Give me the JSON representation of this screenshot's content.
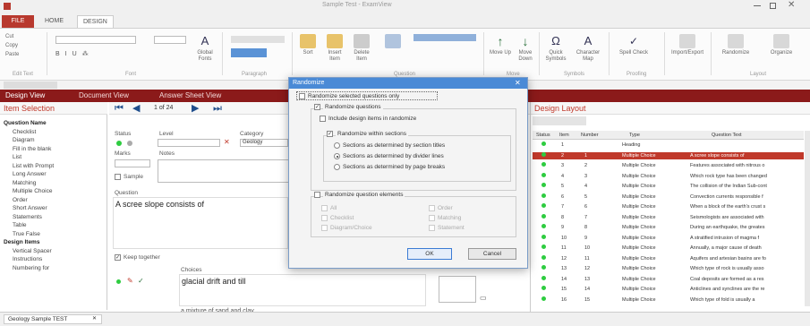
{
  "ribbon": {
    "tabs": [
      "FILE",
      "HOME",
      "DESIGN"
    ],
    "title": "Sample Test - ExamView",
    "groups": [
      "Edit Text",
      "Font",
      "Paragraph",
      "Style",
      "Question",
      "Move",
      "Symbols",
      "Proofing",
      "Window",
      "Layout"
    ],
    "buttons": [
      "Cut",
      "Copy",
      "Paste",
      "Global Fonts",
      "Sort",
      "Insert Item",
      "Delete Item",
      "Move Up",
      "Move Down",
      "Quick Symbols",
      "Character Map",
      "Spell Check",
      "Import/Export",
      "Randomize",
      "Organize"
    ]
  },
  "views": [
    "Design View",
    "Document View",
    "Answer Sheet View"
  ],
  "item_selection": {
    "title": "Item Selection",
    "nav_counter": "1 of 24",
    "tree": [
      {
        "label": "Question Name",
        "header": true
      },
      {
        "label": "Checklist",
        "header": false
      },
      {
        "label": "Diagram",
        "header": false
      },
      {
        "label": "Fill in the blank",
        "header": false
      },
      {
        "label": "List",
        "header": false
      },
      {
        "label": "List with Prompt",
        "header": false
      },
      {
        "label": "Long Answer",
        "header": false
      },
      {
        "label": "Matching",
        "header": false
      },
      {
        "label": "Multiple Choice",
        "header": false
      },
      {
        "label": "Order",
        "header": false
      },
      {
        "label": "Short Answer",
        "header": false
      },
      {
        "label": "Statements",
        "header": false
      },
      {
        "label": "Table",
        "header": false
      },
      {
        "label": "True False",
        "header": false
      },
      {
        "label": "Design Items",
        "header": true
      },
      {
        "label": "Vertical Spacer",
        "header": false
      },
      {
        "label": "Instructions",
        "header": false
      },
      {
        "label": "Numbering for",
        "header": false
      }
    ]
  },
  "editor": {
    "status_label": "Status",
    "level_label": "Level",
    "category_label": "Category",
    "category_value": "Geology",
    "marks_label": "Marks",
    "notes_label": "Notes",
    "sample_label": "Sample",
    "question_label": "Question",
    "question_text": "A scree slope consists of",
    "keep_together_label": "Keep together",
    "choices_label": "Choices",
    "choice_a": "glacial drift and till",
    "choice_b": "a mixture of sand and clay"
  },
  "dialog": {
    "title": "Randomize",
    "selected_only": "Randomize selected questions only",
    "randomize_questions": "Randomize questions",
    "include_design": "Include design items in randomize",
    "randomize_within": "Randomize within sections",
    "radio_1": "Sections as determined by section titles",
    "radio_2": "Sections as determined by divider lines",
    "radio_3": "Sections as determined by page breaks",
    "randomize_elements": "Randomize question elements",
    "elements": [
      "All",
      "Checklist",
      "Diagram/Choice",
      "Order",
      "Matching",
      "Statement"
    ],
    "ok": "OK",
    "cancel": "Cancel"
  },
  "layout": {
    "title": "Design Layout",
    "columns": [
      "Status",
      "Item",
      "Number",
      "Type",
      "Question Text"
    ],
    "rows": [
      {
        "item": "1",
        "number": "",
        "type": "Heading",
        "text": ""
      },
      {
        "item": "2",
        "number": "1",
        "type": "Multiple Choice",
        "text": "A scree slope consists of"
      },
      {
        "item": "3",
        "number": "2",
        "type": "Multiple Choice",
        "text": "Features associated with nitrous o"
      },
      {
        "item": "4",
        "number": "3",
        "type": "Multiple Choice",
        "text": "Which rock type has been changed"
      },
      {
        "item": "5",
        "number": "4",
        "type": "Multiple Choice",
        "text": "The collision of the Indian Sub-cont"
      },
      {
        "item": "6",
        "number": "5",
        "type": "Multiple Choice",
        "text": "Convection currents responsible f"
      },
      {
        "item": "7",
        "number": "6",
        "type": "Multiple Choice",
        "text": "When a block of the earth's crust s"
      },
      {
        "item": "8",
        "number": "7",
        "type": "Multiple Choice",
        "text": "Seismologists are associated with"
      },
      {
        "item": "9",
        "number": "8",
        "type": "Multiple Choice",
        "text": "During an earthquake, the greates"
      },
      {
        "item": "10",
        "number": "9",
        "type": "Multiple Choice",
        "text": "A stratified intrusion of magma f"
      },
      {
        "item": "11",
        "number": "10",
        "type": "Multiple Choice",
        "text": "Annually, a major cause of death"
      },
      {
        "item": "12",
        "number": "11",
        "type": "Multiple Choice",
        "text": "Aquifers and artesian basins are fo"
      },
      {
        "item": "13",
        "number": "12",
        "type": "Multiple Choice",
        "text": "Which type of rock is usually asso"
      },
      {
        "item": "14",
        "number": "13",
        "type": "Multiple Choice",
        "text": "Coal deposits are formed as a res"
      },
      {
        "item": "15",
        "number": "14",
        "type": "Multiple Choice",
        "text": "Anticlines and synclines are the re"
      },
      {
        "item": "16",
        "number": "15",
        "type": "Multiple Choice",
        "text": "Which type of fold is usually a"
      }
    ]
  },
  "status": {
    "doc_tab": "Geology Sample TEST"
  },
  "colors": {
    "brand": "#8b1a1a",
    "accent": "#c0392b",
    "status_ok": "#2ecc40"
  }
}
